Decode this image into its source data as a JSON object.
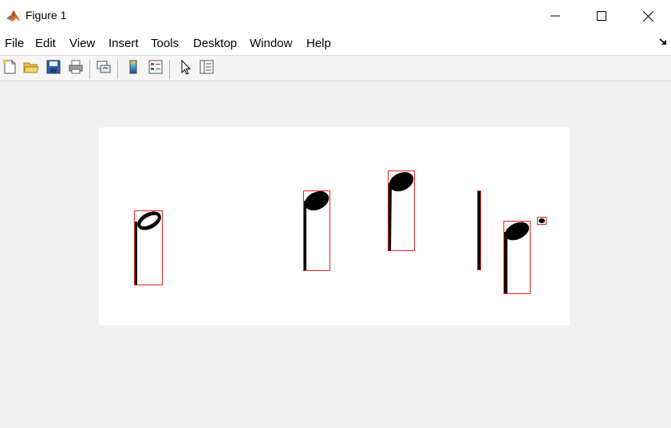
{
  "window": {
    "title": "Figure 1"
  },
  "menu": {
    "items": [
      "File",
      "Edit",
      "View",
      "Insert",
      "Tools",
      "Desktop",
      "Window",
      "Help"
    ]
  },
  "toolbar": {
    "buttons": [
      "new-figure-icon",
      "open-file-icon",
      "save-icon",
      "print-icon",
      "link-plot-icon",
      "insert-colorbar-icon",
      "insert-legend-icon",
      "edit-plot-icon",
      "property-inspector-icon"
    ]
  },
  "colors": {
    "bounding_box": "#e8211f",
    "glyph": "#000000",
    "figure_background": "#f0f0f0",
    "axes_background": "#ffffff"
  }
}
